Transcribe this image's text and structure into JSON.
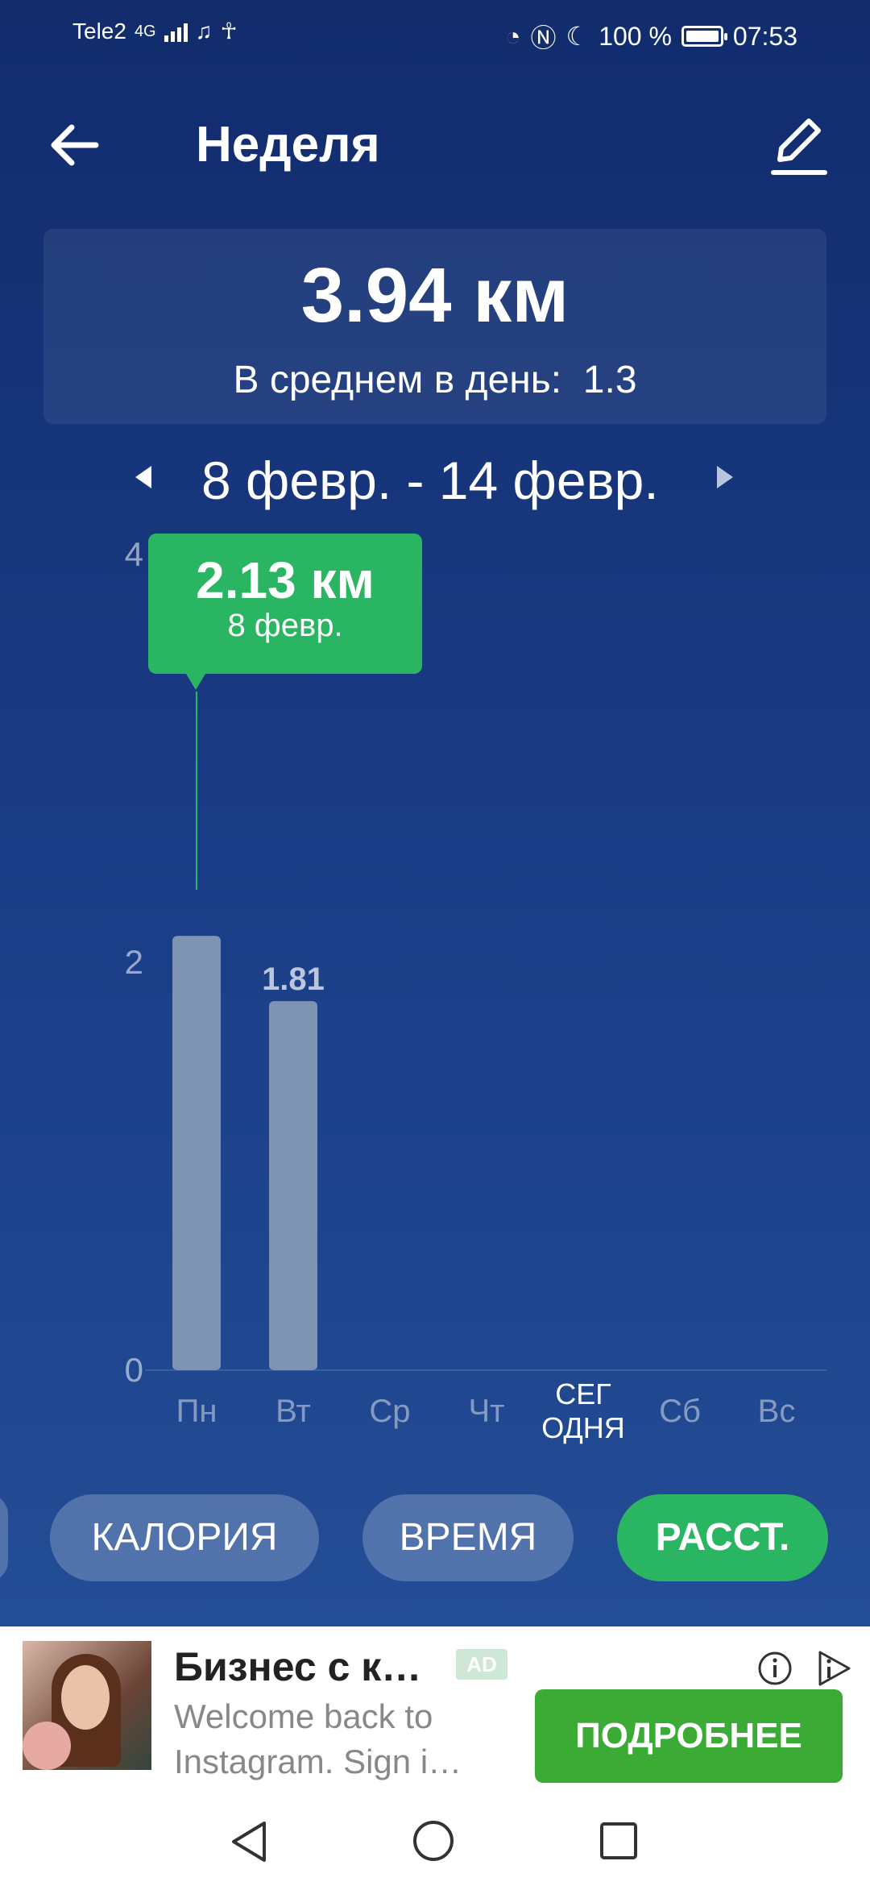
{
  "status_bar": {
    "carrier": "Tele2",
    "network_type": "4G",
    "battery_percent": "100 %",
    "time": "07:53",
    "battery_level": 1.0
  },
  "header": {
    "title": "Неделя"
  },
  "summary": {
    "total_distance": "3.94 км",
    "average_text": "В среднем в день:  1.3"
  },
  "date_range": "8 февр. - 14 февр.",
  "chart_data": {
    "type": "bar",
    "categories": [
      "Пн",
      "Вт",
      "Ср",
      "Чт",
      "СЕГ ОДНЯ",
      "Сб",
      "Вс"
    ],
    "category_lines": [
      [
        "Пн"
      ],
      [
        "Вт"
      ],
      [
        "Ср"
      ],
      [
        "Чт"
      ],
      [
        "СЕГ",
        "ОДНЯ"
      ],
      [
        "Сб"
      ],
      [
        "Вс"
      ]
    ],
    "values": [
      2.13,
      1.81,
      0,
      0,
      0,
      0,
      0
    ],
    "value_labels": [
      "",
      "1.81",
      "",
      "",
      "",
      "",
      ""
    ],
    "y_ticks": [
      "0",
      "2",
      "4"
    ],
    "ylim": [
      0,
      4
    ],
    "highlight_index": 0,
    "today_index": 4,
    "bar_color": "#7f93b5",
    "tooltip": {
      "value": "2.13 км",
      "date": "8 февр."
    }
  },
  "tabs": [
    {
      "label": "КАЛОРИЯ",
      "active": false
    },
    {
      "label": "ВРЕМЯ",
      "active": false
    },
    {
      "label": "РАССТ.",
      "active": true
    }
  ],
  "ad": {
    "title": "Бизнес с к…",
    "badge": "AD",
    "description": "Welcome back to Instagram. Sign i…",
    "cta": "ПОДРОБНЕЕ"
  },
  "colors": {
    "accent_green": "#2ab563",
    "cta_green": "#3bab36",
    "background_top": "#122c6c",
    "background_bottom": "#26539b"
  }
}
